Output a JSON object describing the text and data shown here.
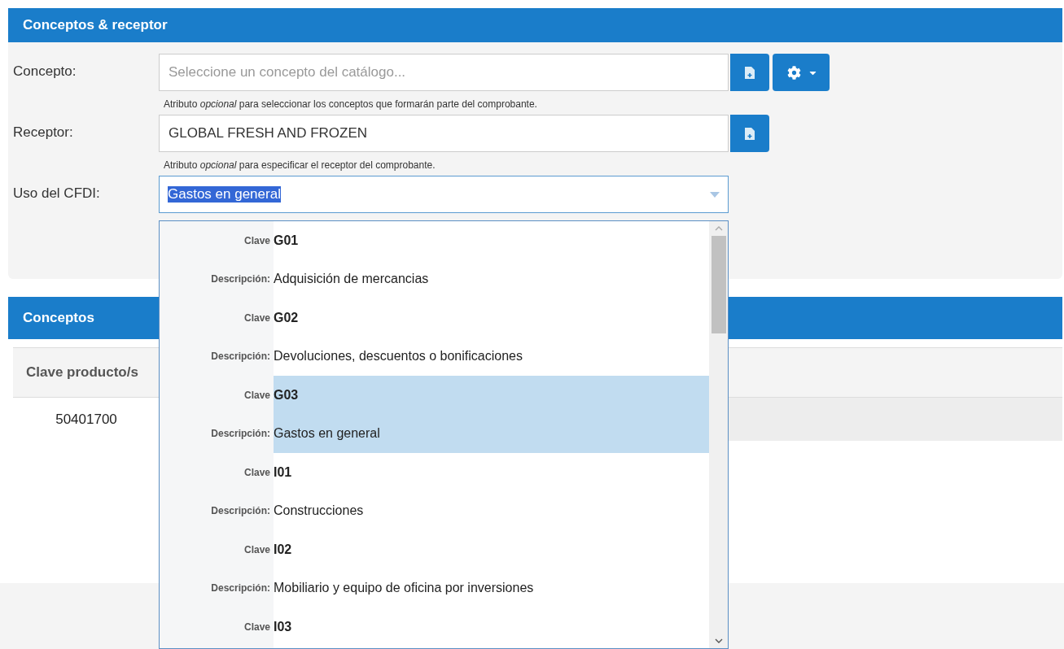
{
  "receptor_panel": {
    "title": "Conceptos & receptor",
    "concepto": {
      "label": "Concepto:",
      "placeholder": "Seleccione un concepto del catálogo...",
      "help": "Atributo *opcional* para seleccionar los conceptos que formarán parte del comprobante."
    },
    "receptor": {
      "label": "Receptor:",
      "value": "GLOBAL FRESH AND FROZEN",
      "help": "Atributo *opcional* para especificar el receptor del comprobante."
    },
    "uso_cfdi": {
      "label": "Uso del CFDI:",
      "value": "Gastos en general",
      "expanded": true,
      "options": [
        {
          "clave_label": "Clave",
          "clave": "G01",
          "descripcion_label": "Descripción:",
          "descripcion": "Adquisición de mercancias",
          "selected": false
        },
        {
          "clave_label": "Clave",
          "clave": "G02",
          "descripcion_label": "Descripción:",
          "descripcion": "Devoluciones, descuentos o bonificaciones",
          "selected": false
        },
        {
          "clave_label": "Clave",
          "clave": "G03",
          "descripcion_label": "Descripción:",
          "descripcion": "Gastos en general",
          "selected": true
        },
        {
          "clave_label": "Clave",
          "clave": "I01",
          "descripcion_label": "Descripción:",
          "descripcion": "Construcciones",
          "selected": false
        },
        {
          "clave_label": "Clave",
          "clave": "I02",
          "descripcion_label": "Descripción:",
          "descripcion": "Mobiliario y equipo de oficina por inversiones",
          "selected": false
        },
        {
          "clave_label": "Clave",
          "clave": "I03",
          "selected": false
        }
      ]
    }
  },
  "conceptos_panel": {
    "title": "Conceptos",
    "table": {
      "columns": [
        "Clave producto/s"
      ],
      "rows": [
        [
          "50401700"
        ]
      ]
    }
  }
}
